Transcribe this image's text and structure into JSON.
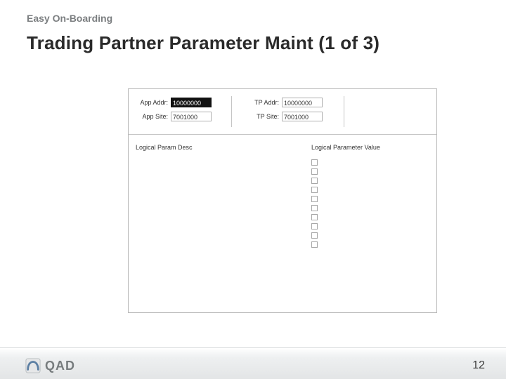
{
  "pretitle": "Easy On-Boarding",
  "title": "Trading Partner Parameter Maint (1 of 3)",
  "fields": {
    "app_addr_label": "App Addr:",
    "app_addr_value": "10000000",
    "app_site_label": "App Site:",
    "app_site_value": "7001000",
    "tp_addr_label": "TP Addr:",
    "tp_addr_value": "10000000",
    "tp_site_label": "TP Site:",
    "tp_site_value": "7001000"
  },
  "columns": {
    "desc": "Logical Param Desc",
    "value": "Logical Parameter Value"
  },
  "checkbox_count": 10,
  "brand": "QAD",
  "page_number": "12"
}
